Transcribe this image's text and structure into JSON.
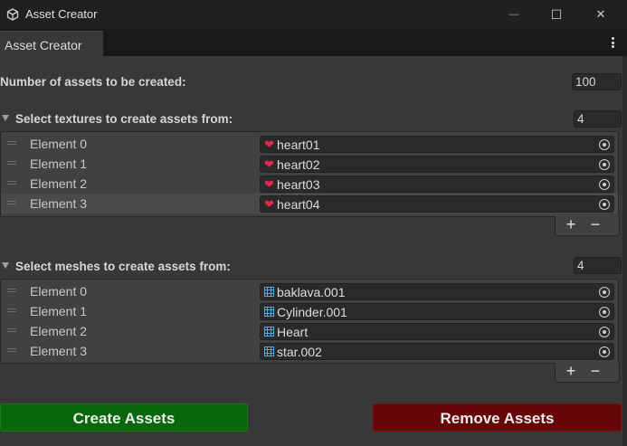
{
  "window": {
    "title": "Asset Creator",
    "icons": {
      "app": "unity-cube-icon",
      "minimize": "minimize-icon",
      "maximize": "maximize-icon",
      "close": "close-icon"
    },
    "minimize_glyph": "—",
    "maximize_glyph": "☐",
    "close_glyph": "✕"
  },
  "tab": {
    "label": "Asset Creator",
    "menu_icon": "kebab-menu-icon"
  },
  "form": {
    "count_label": "Number of assets to be created:",
    "count_value": "100"
  },
  "textures": {
    "header": "Select textures to create assets from:",
    "size": "4",
    "item_icon": "heart-texture-icon",
    "item_glyph": "❤",
    "elements": [
      {
        "label": "Element 0",
        "value": "heart01"
      },
      {
        "label": "Element 1",
        "value": "heart02"
      },
      {
        "label": "Element 2",
        "value": "heart03"
      },
      {
        "label": "Element 3",
        "value": "heart04"
      }
    ],
    "add": "+",
    "remove": "−"
  },
  "meshes": {
    "header": "Select meshes to create assets from:",
    "size": "4",
    "item_icon": "mesh-grid-icon",
    "elements": [
      {
        "label": "Element 0",
        "value": "baklava.001"
      },
      {
        "label": "Element 1",
        "value": "Cylinder.001"
      },
      {
        "label": "Element 2",
        "value": "Heart"
      },
      {
        "label": "Element 3",
        "value": "star.002"
      }
    ],
    "add": "+",
    "remove": "−"
  },
  "actions": {
    "create": "Create Assets",
    "remove": "Remove Assets"
  },
  "colors": {
    "create_button": "#0a660a",
    "remove_button": "#660707",
    "heart_icon": "#e6284a",
    "mesh_icon": "#5aa8e0"
  }
}
